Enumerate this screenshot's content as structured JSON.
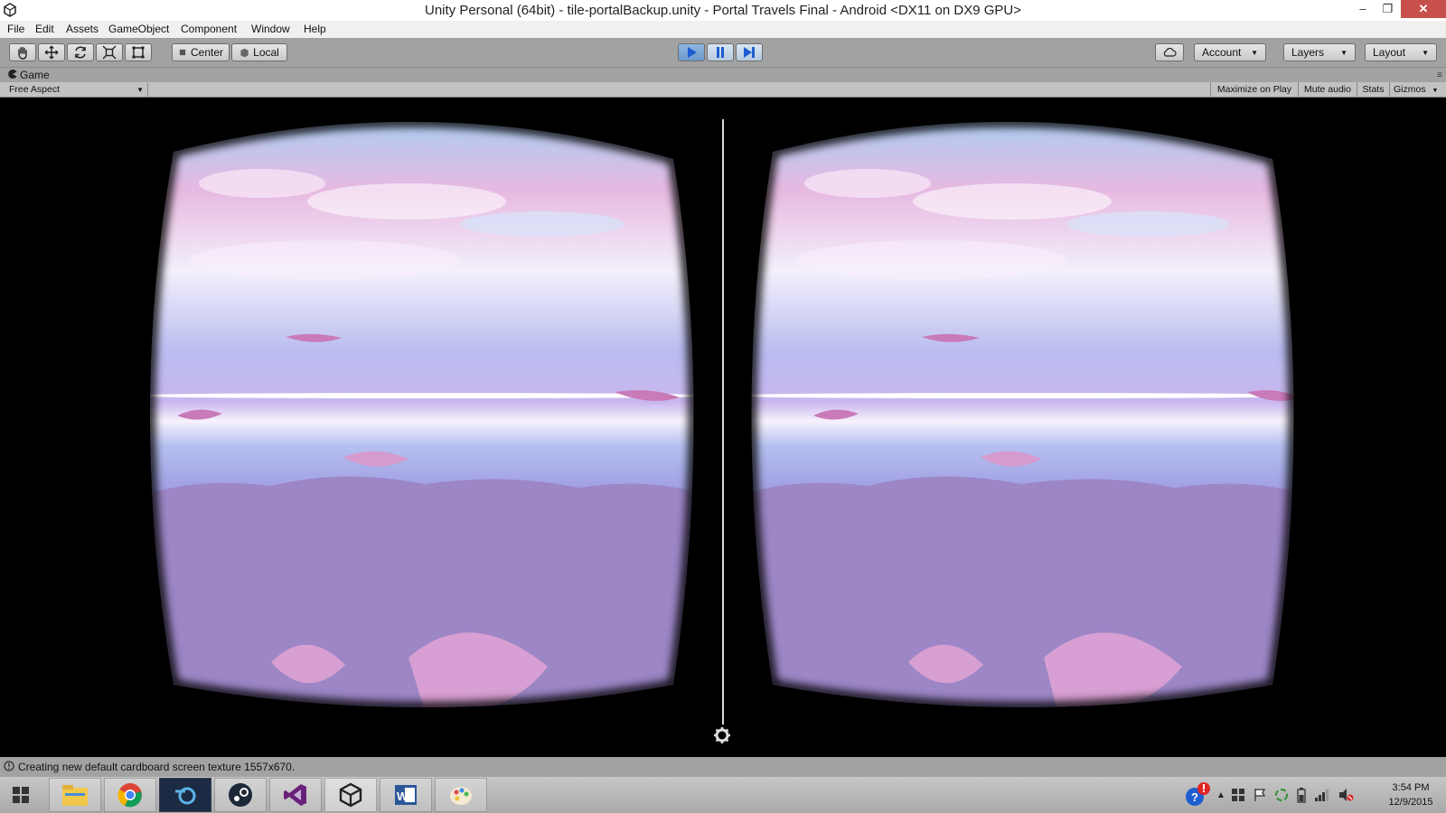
{
  "window": {
    "title": "Unity Personal (64bit) - tile-portalBackup.unity - Portal Travels Final - Android <DX11 on DX9 GPU>",
    "minimize": "–",
    "maximize": "❐",
    "close": "✕"
  },
  "menu": [
    "File",
    "Edit",
    "Assets",
    "GameObject",
    "Component",
    "Window",
    "Help"
  ],
  "toolbar": {
    "pivot_label": "Center",
    "space_label": "Local",
    "account_label": "Account",
    "layers_label": "Layers",
    "layout_label": "Layout",
    "play_active": true
  },
  "game_panel": {
    "tab_label": "Game",
    "aspect": "Free Aspect",
    "maximize_on_play": "Maximize on Play",
    "mute_audio": "Mute audio",
    "stats": "Stats",
    "gizmos": "Gizmos"
  },
  "status": {
    "message": "Creating new default cardboard screen texture 1557x670."
  },
  "taskbar": {
    "apps": [
      "start-icon",
      "file-explorer-icon",
      "chrome-icon",
      "blender-icon",
      "steam-icon",
      "visual-studio-icon",
      "unity-icon",
      "word-icon",
      "paint-icon"
    ],
    "clock_time": "3:54 PM",
    "clock_date": "12/9/2015"
  },
  "colors": {
    "sky_top": "#9fc7ef",
    "sky_pink": "#e9b7e0",
    "horizon": "#f4eefc",
    "cloud_floor": "#9a86c4",
    "lotus": "#c98fc6",
    "close_button": "#c7504b"
  }
}
